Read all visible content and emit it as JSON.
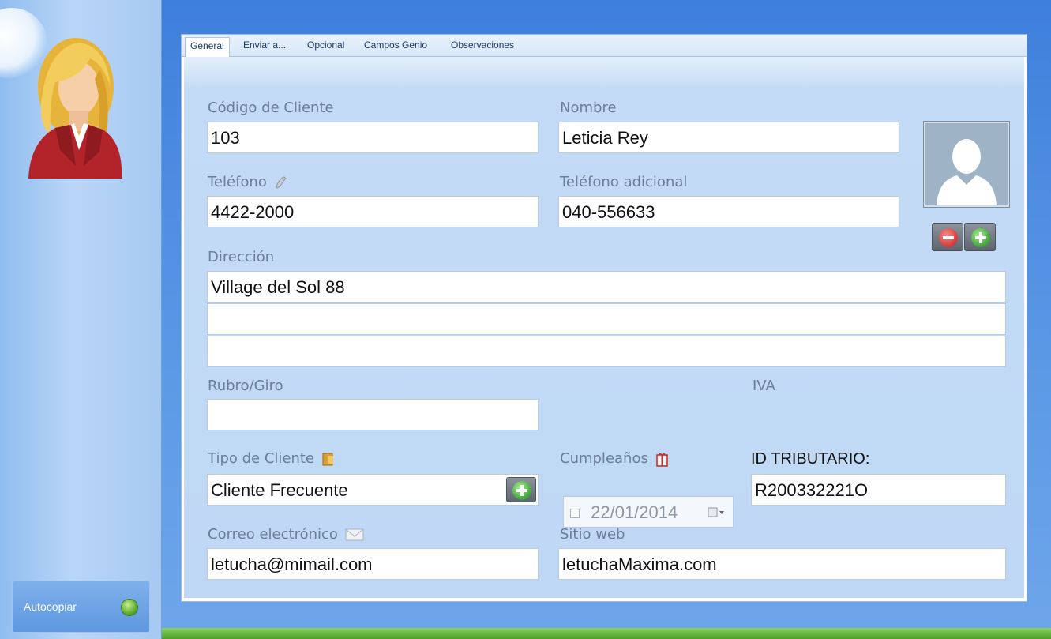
{
  "sidebar": {
    "autocopy_label": "Autocopiar"
  },
  "tabs": [
    {
      "label": "General",
      "active": true
    },
    {
      "label": "Enviar a...",
      "active": false
    },
    {
      "label": "Opcional",
      "active": false
    },
    {
      "label": "Campos Genio",
      "active": false
    },
    {
      "label": "Observaciones",
      "active": false
    }
  ],
  "form": {
    "codigo": {
      "label": "Código de Cliente",
      "value": "103"
    },
    "nombre": {
      "label": "Nombre",
      "value": "Leticia Rey"
    },
    "telefono": {
      "label": "Teléfono",
      "value": "4422-2000"
    },
    "telefono_adicional": {
      "label": "Teléfono adicional",
      "value": "040-556633"
    },
    "direccion": {
      "label": "Dirección",
      "lines": [
        "Village del Sol 88",
        "",
        ""
      ]
    },
    "rubro": {
      "label": "Rubro/Giro",
      "value": ""
    },
    "iva": {
      "label": "IVA"
    },
    "tipo_cliente": {
      "label": "Tipo de Cliente",
      "value": "Cliente Frecuente"
    },
    "cumpleanos": {
      "label": "Cumpleaños",
      "value": "22/01/2014",
      "checked": false
    },
    "id_tributario": {
      "label": "ID TRIBUTARIO:",
      "value": "R200332221O"
    },
    "correo": {
      "label": "Correo electrónico",
      "value": "letucha@mimail.com"
    },
    "sitio_web": {
      "label": "Sitio web",
      "value": "letuchaMaxima.com"
    }
  },
  "colors": {
    "accent_blue": "#4f8fe0",
    "form_bg": "#bfd8f5",
    "label_gray": "#6b7d96",
    "add_green": "#3fa33a",
    "remove_red": "#d33a3a"
  },
  "icons": {
    "phone": "phone-handset-icon",
    "gift": "gift-icon",
    "folder": "folder-icon",
    "mail": "envelope-icon",
    "photo": "user-silhouette-icon",
    "autocopy": "refresh-icon"
  }
}
